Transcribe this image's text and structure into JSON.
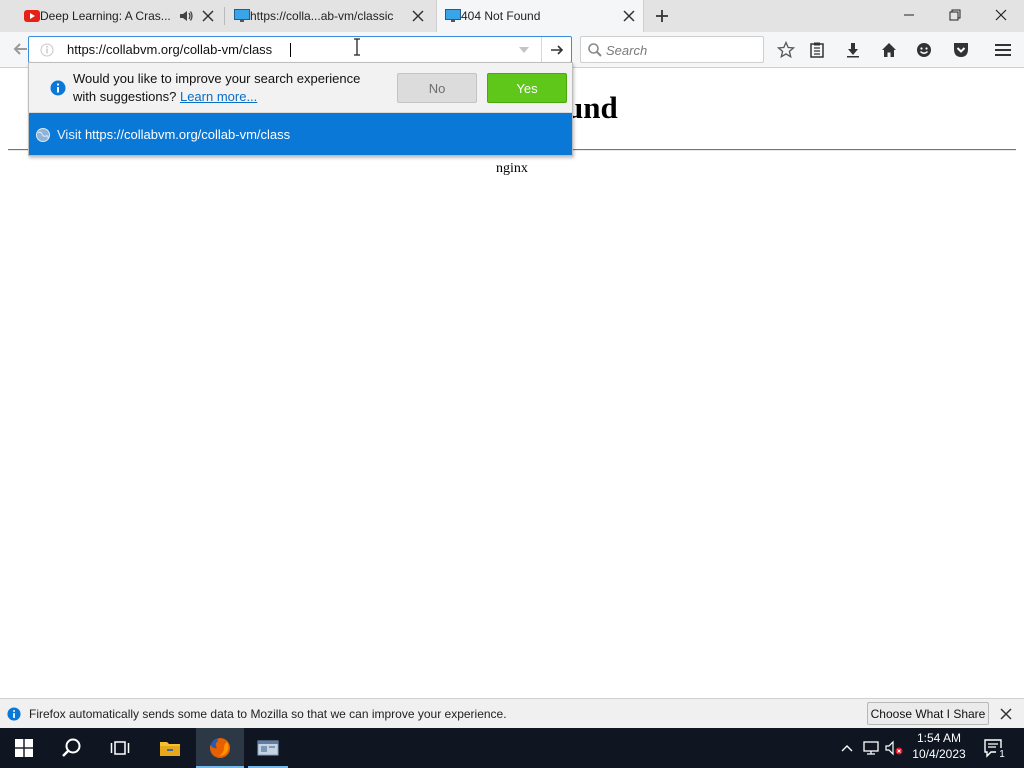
{
  "tabs": [
    {
      "title": "Deep Learning: A Cras...",
      "favicon": "youtube-icon",
      "audio": "speaker-icon",
      "active": false
    },
    {
      "title": "https://colla...ab-vm/classic",
      "favicon": "monitor-icon",
      "active": false
    },
    {
      "title": "404 Not Found",
      "favicon": "monitor-icon",
      "active": true
    }
  ],
  "url_bar": {
    "value": "https://collabvm.org/collab-vm/class"
  },
  "search_bar": {
    "placeholder": "Search"
  },
  "toolbar_icons": [
    "star-icon",
    "reading-list-icon",
    "download-icon",
    "home-icon",
    "hello-icon",
    "pocket-icon",
    "menu-icon"
  ],
  "page": {
    "heading_visible": "und",
    "server": "nginx"
  },
  "popup": {
    "prompt_line1": "Would you like to improve your search experience",
    "prompt_line2": "with suggestions?",
    "learn_more": "Learn more...",
    "no_label": "No",
    "yes_label": "Yes",
    "visit_label": "Visit",
    "visit_url": "https://collabvm.org/collab-vm/class"
  },
  "notification": {
    "text": "Firefox automatically sends some data to Mozilla so that we can improve your experience.",
    "button": "Choose What I Share"
  },
  "taskbar": {
    "time": "1:54 AM",
    "date": "10/4/2023",
    "notification_count": "1"
  },
  "colors": {
    "accent": "#0a78d6",
    "yes_button": "#5ec71a",
    "taskbar": "#0f1621"
  }
}
